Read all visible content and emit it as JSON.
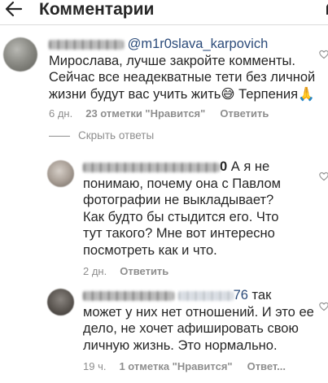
{
  "header": {
    "title": "Комментарии",
    "back_icon": "arrow-left-icon",
    "filter_icon": "filter-icon"
  },
  "comments": [
    {
      "mention": "@m1r0slava_karpovich",
      "lines": [
        "Мирослава, лучше закройте комменты.",
        "Сейчас все неадекватные тети без личной",
        "жизни будут вас учить жить😅 Терпения🙏"
      ],
      "time": "6 дн.",
      "likes": "23 отметки \"Нравится\"",
      "reply": "Ответить"
    }
  ],
  "hide_replies": "Скрыть ответы",
  "replies": [
    {
      "username_tail": "0",
      "lines": [
        "А я не",
        "понимаю, почему она с Павлом",
        "фотографии не выкладывает?",
        "Как будто бы стыдится его. Что",
        "тут такого? Мне вот интересно",
        "посмотреть как и что."
      ],
      "time": "2 дн.",
      "reply": "Ответить"
    },
    {
      "mention_tail": "76",
      "lines": [
        "так",
        "может у них нет отношений. И это ее",
        "дело, не хочет афишировать свою",
        "личную жизнь. Это нормально."
      ],
      "time": "19 ч.",
      "likes": "1 отметка \"Нравится\"",
      "reply": "Ответ..."
    }
  ],
  "colors": {
    "text": "#262626",
    "meta": "#8e8e8e",
    "mention": "#2b4b7a",
    "divider": "#dbdbdb"
  }
}
